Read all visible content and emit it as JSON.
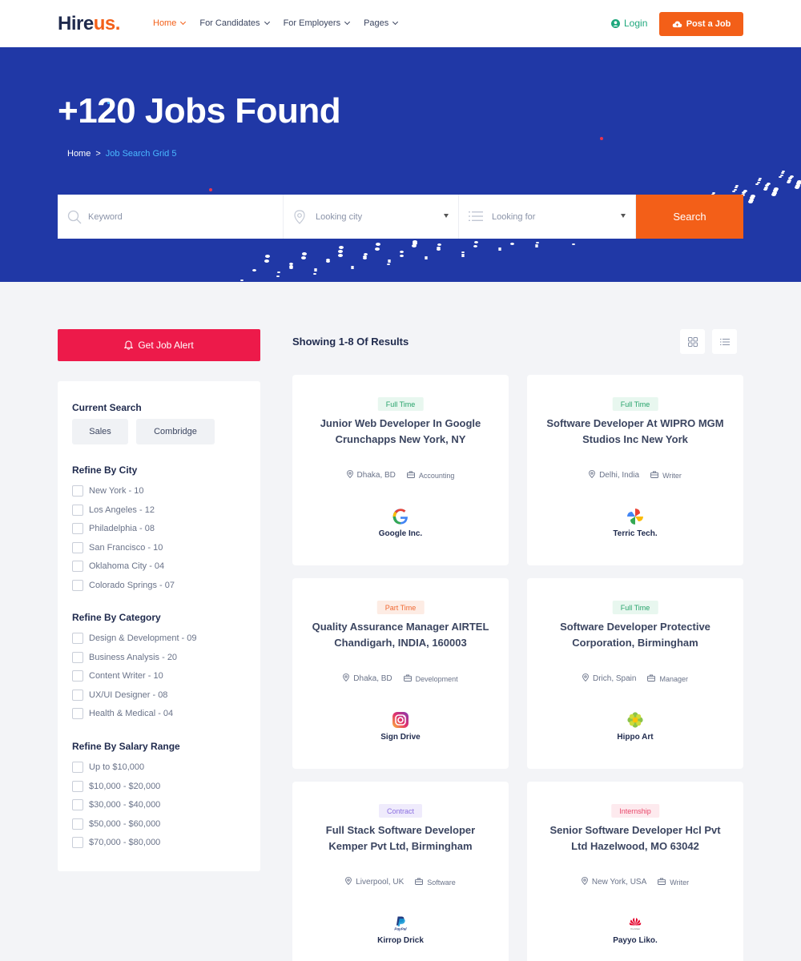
{
  "nav": {
    "logo_main": "Hire",
    "logo_accent": "us.",
    "menu": [
      {
        "label": "Home",
        "active": true
      },
      {
        "label": "For Candidates",
        "active": false
      },
      {
        "label": "For Employers",
        "active": false
      },
      {
        "label": "Pages",
        "active": false
      }
    ],
    "login_label": "Login",
    "post_job_label": "Post a Job"
  },
  "hero": {
    "title": "+120 Jobs Found",
    "breadcrumb": {
      "home": "Home",
      "separator": ">",
      "current": "Job Search Grid 5"
    }
  },
  "search": {
    "keyword_placeholder": "Keyword",
    "city_placeholder": "Looking city",
    "looking_placeholder": "Looking for",
    "button_label": "Search"
  },
  "sidebar": {
    "alert_label": "Get Job Alert",
    "current_search": {
      "heading": "Current Search",
      "tags": [
        "Sales",
        "Combridge"
      ]
    },
    "city": {
      "heading": "Refine By City",
      "items": [
        "New York - 10",
        "Los Angeles - 12",
        "Philadelphia - 08",
        "San Francisco - 10",
        "Oklahoma City - 04",
        "Colorado Springs - 07"
      ]
    },
    "category": {
      "heading": "Refine By Category",
      "items": [
        "Design & Development - 09",
        "Business Analysis - 20",
        "Content Writer - 10",
        "UX/UI Designer - 08",
        "Health & Medical - 04"
      ]
    },
    "salary": {
      "heading": "Refine By Salary Range",
      "items": [
        "Up to $10,000",
        "$10,000 - $20,000",
        "$30,000 - $40,000",
        "$50,000 - $60,000",
        "$70,000 - $80,000"
      ]
    }
  },
  "results": {
    "heading": "Showing 1-8 Of Results",
    "jobs": [
      {
        "type": "Full Time",
        "title": "Junior Web Developer In Google Crunchapps New York, NY",
        "location": "Dhaka, BD",
        "category": "Accounting",
        "company": "Google Inc.",
        "logo": "google-logo"
      },
      {
        "type": "Full Time",
        "title": "Software Developer At WIPRO MGM Studios Inc New York",
        "location": "Delhi, India",
        "category": "Writer",
        "company": "Terric Tech.",
        "logo": "pinwheel-logo"
      },
      {
        "type": "Part Time",
        "title": "Quality Assurance Manager AIRTEL Chandigarh, INDIA, 160003",
        "location": "Dhaka, BD",
        "category": "Development",
        "company": "Sign Drive",
        "logo": "instagram-logo"
      },
      {
        "type": "Full Time",
        "title": "Software Developer Protective Corporation, Birmingham",
        "location": "Drich, Spain",
        "category": "Manager",
        "company": "Hippo Art",
        "logo": "flower-logo"
      },
      {
        "type": "Contract",
        "title": "Full Stack Software Developer Kemper Pvt Ltd, Birmingham",
        "location": "Liverpool, UK",
        "category": "Software",
        "company": "Kirrop Drick",
        "logo": "paypal-logo"
      },
      {
        "type": "Internship",
        "title": "Senior Software Developer Hcl Pvt Ltd Hazelwood, MO 63042",
        "location": "New York, USA",
        "category": "Writer",
        "company": "Payyo Liko.",
        "logo": "huawei-logo"
      }
    ]
  },
  "colors": {
    "primary": "#2038a6",
    "accent": "#f35f18",
    "alert": "#ed1a4a",
    "login": "#1ea77c"
  }
}
